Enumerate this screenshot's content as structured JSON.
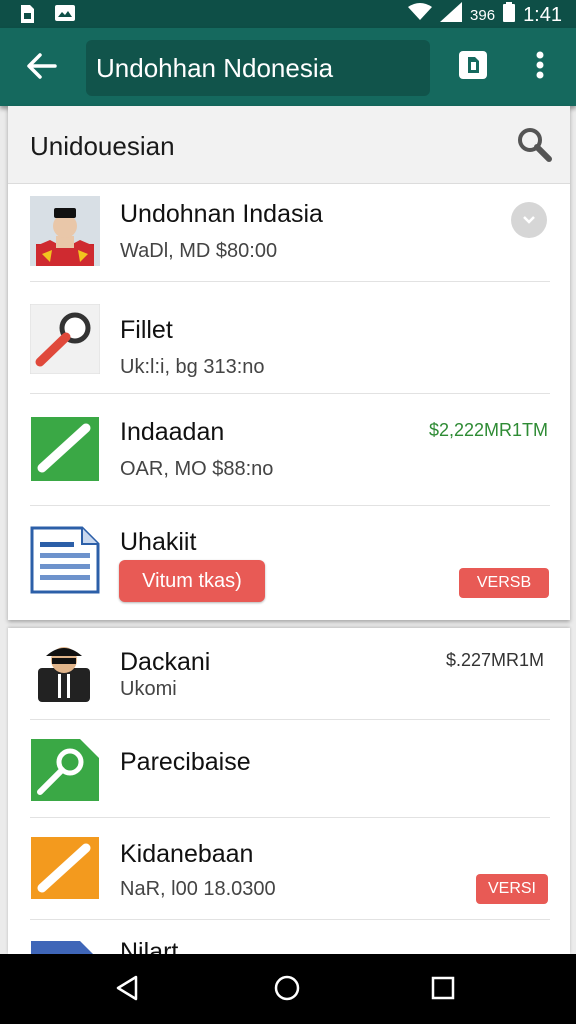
{
  "status_bar": {
    "battery_percent": "396",
    "time": "1:41"
  },
  "app_bar": {
    "title": "Undohhan Ndonesia"
  },
  "search_header": {
    "label": "Unidouesian"
  },
  "list_top": [
    {
      "title": "Undohnan Indasia",
      "subtitle": "WaDl, MD $80:00"
    },
    {
      "title": "Fillet",
      "subtitle": "Uk:l:i, bg 313:no"
    },
    {
      "title": "Indaadan",
      "subtitle": "OAR, MO $88:no",
      "amount": "$2,222MR1TM"
    },
    {
      "title": "Uhakiit",
      "button_label": "Vitum tkas)",
      "tag": "VERSB"
    }
  ],
  "list_bottom": [
    {
      "title": "Dackani",
      "subtitle": "Ukomi",
      "amount": "$.227MR1M"
    },
    {
      "title": "Parecibaise"
    },
    {
      "title": "Kidanebaan",
      "subtitle": "NaR, l00 18.0300",
      "tag": "VERSI"
    },
    {
      "title": "Nilart"
    }
  ],
  "colors": {
    "status_bar": "#0e4f47",
    "app_bar": "#15695e",
    "accent_red": "#e85a55",
    "accent_green": "#2e8b34"
  },
  "icons": {
    "back": "arrow-left-icon",
    "doc": "document-icon",
    "more": "more-vertical-icon",
    "search": "search-icon"
  }
}
